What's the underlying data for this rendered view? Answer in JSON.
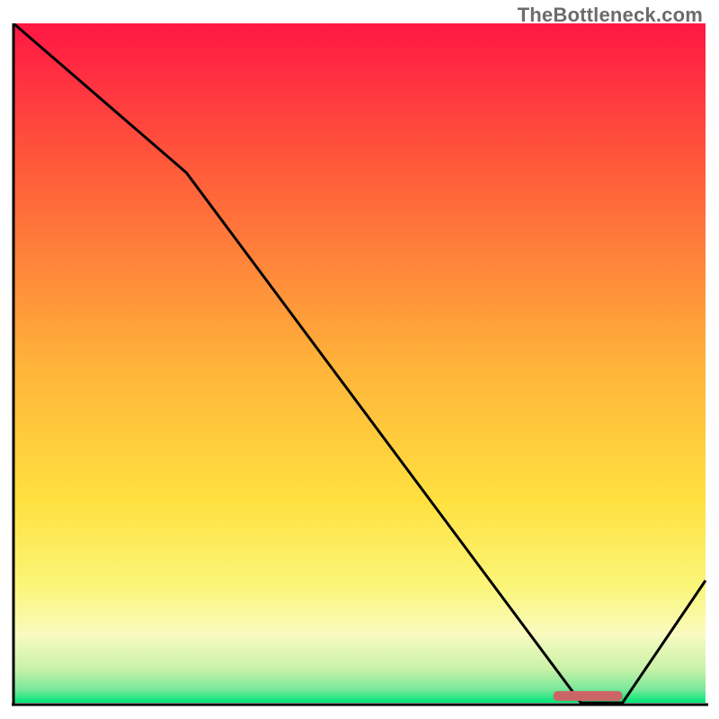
{
  "watermark": "TheBottleneck.com",
  "colors": {
    "gradient_top": "#ff1744",
    "gradient_mid_upper": "#ff6d3a",
    "gradient_mid": "#ffd23f",
    "gradient_lower_yellow": "#f9f99a",
    "gradient_near_bottom": "#b8f0a6",
    "gradient_bottom": "#00e676",
    "curve": "#000000",
    "marker": "#cc6666",
    "axes": "#000000"
  },
  "chart_data": {
    "type": "line",
    "title": "",
    "xlabel": "",
    "ylabel": "",
    "xlim": [
      0,
      100
    ],
    "ylim": [
      0,
      100
    ],
    "x": [
      0,
      25,
      82,
      88,
      100
    ],
    "values": [
      100,
      78,
      0,
      0,
      18
    ],
    "marker_range_x": [
      78,
      88
    ],
    "marker_y": 1
  }
}
